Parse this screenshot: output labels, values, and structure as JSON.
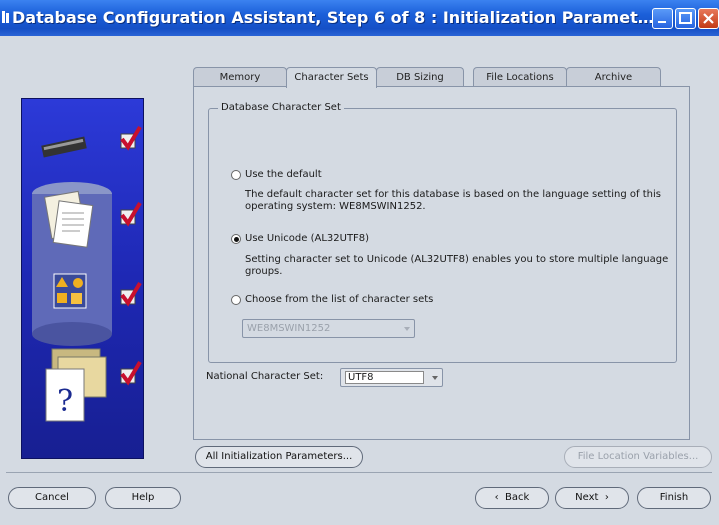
{
  "window": {
    "title": "Database Configuration Assistant, Step 6 of 8 : Initialization Paramet…"
  },
  "tabs": [
    {
      "label": "Memory"
    },
    {
      "label": "Character Sets"
    },
    {
      "label": "DB Sizing"
    },
    {
      "label": "File Locations"
    },
    {
      "label": "Archive"
    }
  ],
  "charset_group": {
    "title": "Database Character Set",
    "options": [
      {
        "label": "Use the default",
        "selected": false,
        "desc1": "The default character set for this database is based on the language setting of this",
        "desc2": "operating system: WE8MSWIN1252."
      },
      {
        "label": "Use Unicode (AL32UTF8)",
        "selected": true,
        "desc1": "Setting character set to Unicode (AL32UTF8) enables you to store multiple language",
        "desc2": "groups."
      },
      {
        "label": "Choose from the list of character sets",
        "selected": false
      }
    ],
    "list_value": "WE8MSWIN1252"
  },
  "national": {
    "label": "National Character Set:",
    "value": "UTF8"
  },
  "buttons": {
    "all_params": "All Initialization Parameters...",
    "file_loc_vars": "File Location Variables...",
    "cancel": "Cancel",
    "help": "Help",
    "back": "Back",
    "next": "Next",
    "finish": "Finish"
  },
  "colors": {
    "titlebar": "#1b5fd9",
    "side_panel": "#1e28b4",
    "check": "#c8102e"
  }
}
